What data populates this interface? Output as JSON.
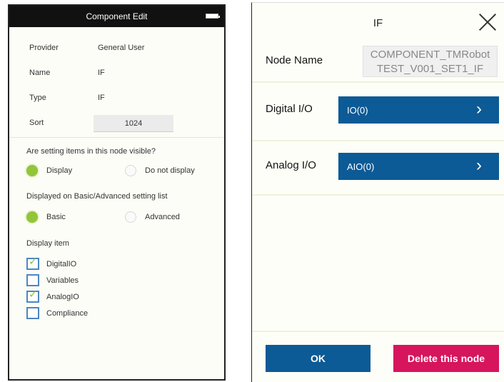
{
  "left_panel": {
    "title": "Component Edit",
    "properties": {
      "provider_label": "Provider",
      "provider_value": "General User",
      "name_label": "Name",
      "name_value": "IF",
      "type_label": "Type",
      "type_value": "IF",
      "sort_label": "Sort",
      "sort_value": "1024"
    },
    "visible_question": "Are setting items in this node visible?",
    "visible_options": {
      "display": "Display",
      "do_not_display": "Do not display",
      "selected": "Display"
    },
    "list_question": "Displayed on Basic/Advanced setting list",
    "list_options": {
      "basic": "Basic",
      "advanced": "Advanced",
      "selected": "Basic"
    },
    "display_item_title": "Display item",
    "display_items": [
      {
        "label": "DigitalIO",
        "checked": true
      },
      {
        "label": "Variables",
        "checked": false
      },
      {
        "label": "AnalogIO",
        "checked": true
      },
      {
        "label": "Compliance",
        "checked": false
      }
    ]
  },
  "right_panel": {
    "title": "IF",
    "node_name_label": "Node Name",
    "node_name_line1": "COMPONENT_TMRobot",
    "node_name_line2": "TEST_V001_SET1_IF",
    "digital_label": "Digital I/O",
    "digital_button": "IO(0)",
    "analog_label": "Analog I/O",
    "analog_button": "AIO(0)",
    "ok_label": "OK",
    "delete_label": "Delete this node"
  },
  "colors": {
    "accent_blue": "#0c5a96",
    "delete_pink": "#d6155d",
    "radio_green": "#92c53a",
    "checkbox_blue": "#4d86c2"
  }
}
